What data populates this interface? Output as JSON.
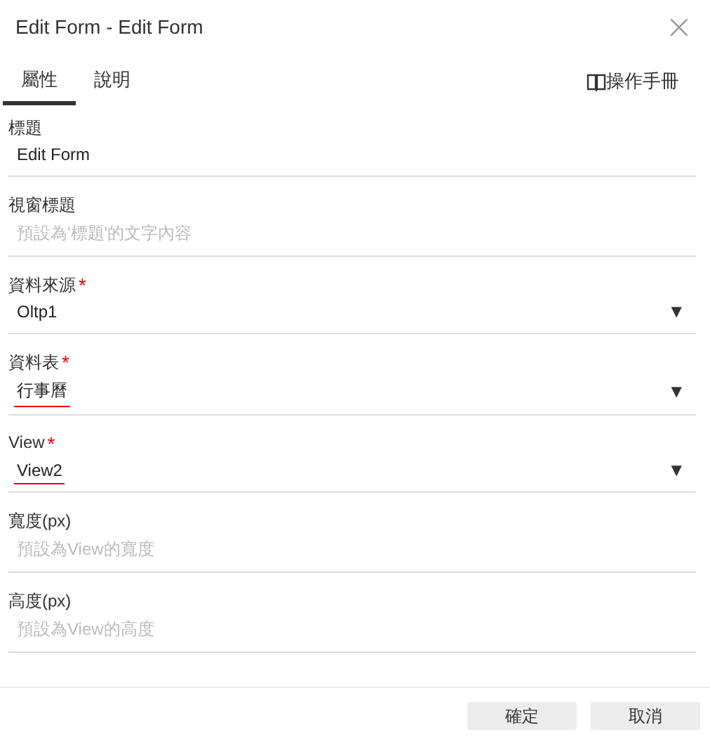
{
  "window": {
    "title": "Edit Form - Edit Form",
    "close": "×"
  },
  "tabs": [
    {
      "label": "屬性",
      "selected": true
    },
    {
      "label": "說明",
      "selected": false
    }
  ],
  "manual_link": "操作手冊",
  "fields": [
    {
      "kind": "text",
      "label": "標題",
      "value": "Edit Form"
    },
    {
      "kind": "text",
      "label": "視窗標題",
      "placeholder": "預設為'標題'的文字內容"
    },
    {
      "kind": "select",
      "label": "資料來源",
      "required_mark": "*",
      "value": "Oltp1",
      "arrow": "▼",
      "underlined": false
    },
    {
      "kind": "select",
      "label": "資料表",
      "required_mark": "*",
      "value": "行事曆",
      "arrow": "▼",
      "underlined": true
    },
    {
      "kind": "select",
      "label": "View",
      "required_mark": "*",
      "value": "View2",
      "arrow": "▼",
      "underlined": true
    },
    {
      "kind": "text",
      "label": "寬度(px)",
      "placeholder": "預設為View的寬度"
    },
    {
      "kind": "text",
      "label": "高度(px)",
      "placeholder": "預設為View的高度"
    }
  ],
  "buttons": [
    "確定",
    "取消"
  ]
}
